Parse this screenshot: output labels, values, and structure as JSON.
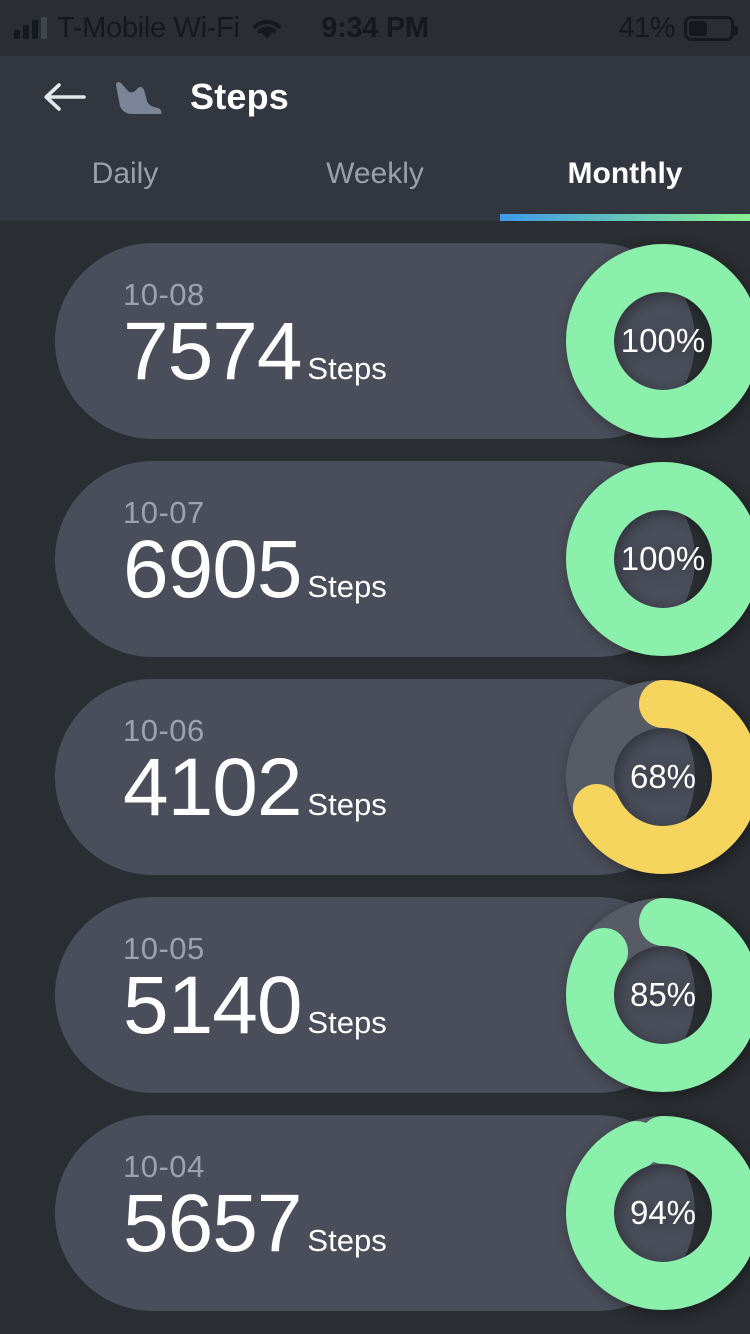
{
  "status_bar": {
    "carrier": "T-Mobile Wi-Fi",
    "time": "9:34 PM",
    "battery_percent": "41%",
    "battery_level": 41,
    "signal_icon": "signal-bars-icon",
    "wifi_icon": "wifi-icon",
    "battery_icon": "battery-icon"
  },
  "header": {
    "back_icon": "back-arrow-icon",
    "activity_icon": "shoe-icon",
    "title": "Steps",
    "tabs": [
      {
        "label": "Daily",
        "active": false
      },
      {
        "label": "Weekly",
        "active": false
      },
      {
        "label": "Monthly",
        "active": true
      }
    ],
    "active_tab_index": 2,
    "underline_gradient_from": "#3e9ae6",
    "underline_gradient_to": "#8bf08f"
  },
  "colors": {
    "page_background": "#2a2d31",
    "header_background": "#32363f",
    "card_background": "#4a4e5a",
    "ring_track": "#565b66",
    "ring_green": "#8bf0ab",
    "ring_yellow": "#f5d55e",
    "text_primary": "#ffffff",
    "text_muted": "#9aa3af"
  },
  "unit_label": "Steps",
  "entries": [
    {
      "date": "10-08",
      "steps": "7574",
      "percent": "100%",
      "percent_value": 100,
      "ring_color": "#8bf0ab"
    },
    {
      "date": "10-07",
      "steps": "6905",
      "percent": "100%",
      "percent_value": 100,
      "ring_color": "#8bf0ab"
    },
    {
      "date": "10-06",
      "steps": "4102",
      "percent": "68%",
      "percent_value": 68,
      "ring_color": "#f5d55e"
    },
    {
      "date": "10-05",
      "steps": "5140",
      "percent": "85%",
      "percent_value": 85,
      "ring_color": "#8bf0ab"
    },
    {
      "date": "10-04",
      "steps": "5657",
      "percent": "94%",
      "percent_value": 94,
      "ring_color": "#8bf0ab"
    }
  ]
}
